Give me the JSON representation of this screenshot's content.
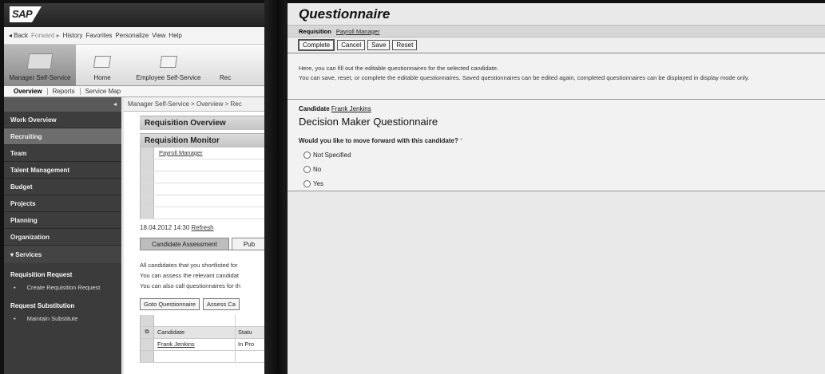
{
  "portal": {
    "logo_text": "SAP",
    "menu": {
      "back": "◂ Back",
      "forward": "Forward ▸",
      "history": "History",
      "favorites": "Favorites",
      "personalize": "Personalize",
      "view": "View",
      "help": "Help"
    },
    "launchpad": [
      {
        "label": "Manager Self-Service",
        "active": true
      },
      {
        "label": "Home"
      },
      {
        "label": "Employee Self-Service"
      },
      {
        "label": "Rec"
      }
    ],
    "subnav": [
      "Overview",
      "Reports",
      "Service Map"
    ],
    "breadcrumb": "Manager Self-Service  >  Overview  >  Rec",
    "nav_collapse": "◂",
    "nav_items": [
      "Work Overview",
      "Recruiting",
      "Team",
      "Talent Management",
      "Budget",
      "Projects",
      "Planning",
      "Organization"
    ],
    "services_label": "▾ Services",
    "service_groups": [
      {
        "heading": "Requisition Request",
        "link": "Create Requisition Request"
      },
      {
        "heading": "Request Substitution",
        "link": "Maintain Substitute"
      }
    ],
    "req_overview_title": "Requisition Overview",
    "req_monitor_title": "Requisition Monitor",
    "monitor_rows": [
      "Payroll Manager",
      "",
      "",
      "",
      "",
      ""
    ],
    "refresh_timestamp": "18.04.2012 14:30",
    "refresh_link": "Refresh",
    "tabs": [
      "Candidate Assessment",
      "Pub"
    ],
    "assess_text": [
      "All candidates that you shortlisted for",
      "You can assess the relevant candidat",
      "You can also call questionnaires for th"
    ],
    "buttons": [
      "Goto Questionnaire",
      "Assess Ca"
    ],
    "cand_table": {
      "headers": [
        "Candidate",
        "Statu"
      ],
      "rows": [
        [
          "Frank Jenkins",
          "In Pro"
        ]
      ]
    }
  },
  "questionnaire": {
    "title": "Questionnaire",
    "subbar_label": "Requisition",
    "subbar_link": "Payroll Manager",
    "toolbar": [
      "Complete",
      "Cancel",
      "Save",
      "Reset"
    ],
    "info_line1": "Here, you can fill out the editable questionnaires for the selected candidate.",
    "info_line2": "You can save, reset, or complete the editable questionnaires. Saved questionnaires can be edited again, completed questionnaires can be displayed in display mode only.",
    "candidate_label": "Candidate",
    "candidate_name": "Frank Jenkins",
    "heading": "Decision Maker Questionnaire",
    "question": "Would you like to move forward with this candidate?",
    "required_mark": "*",
    "options": [
      "Not Specified",
      "No",
      "Yes"
    ]
  }
}
